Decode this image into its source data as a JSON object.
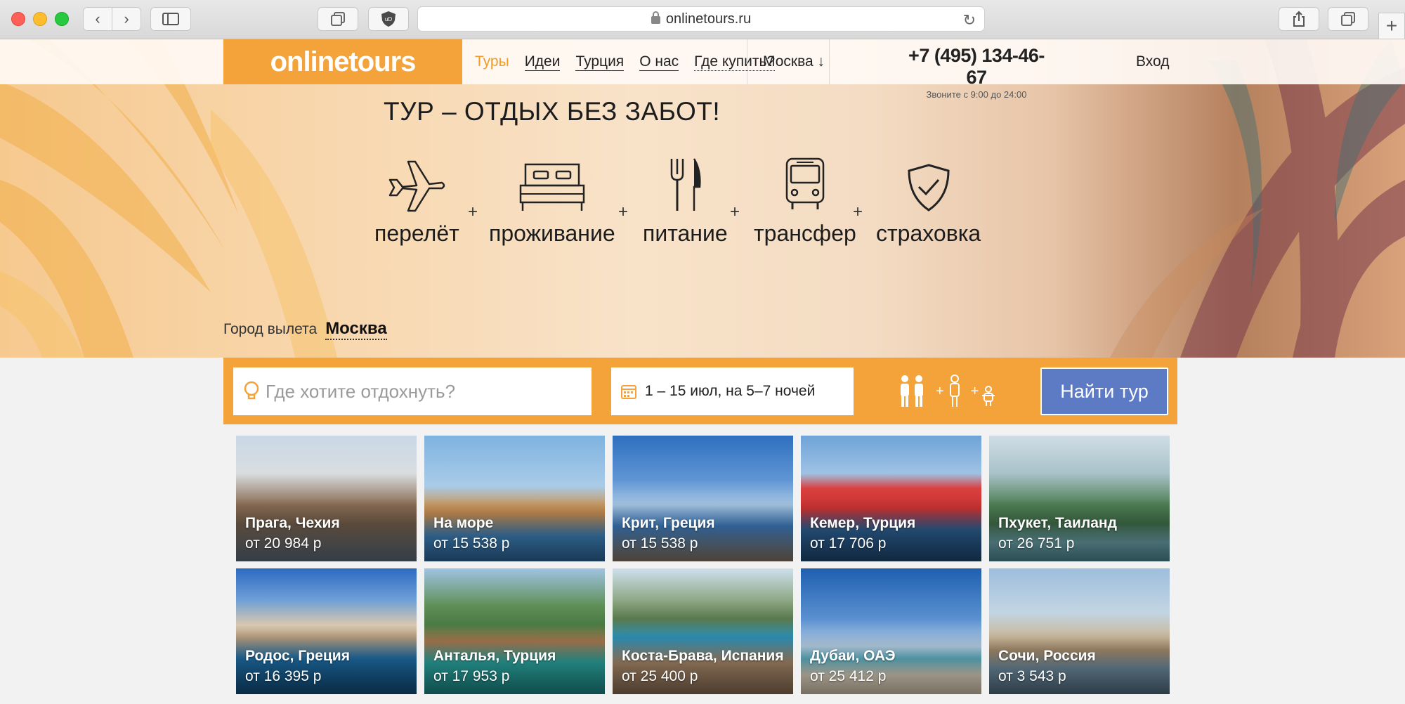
{
  "browser": {
    "url": "onlinetours.ru"
  },
  "header": {
    "logo": "onlinetours",
    "nav": [
      {
        "label": "Туры"
      },
      {
        "label": "Идеи"
      },
      {
        "label": "Турция"
      },
      {
        "label": "О нас"
      },
      {
        "label": "Где купить?"
      }
    ],
    "city": "Москва ↓",
    "phone": "+7 (495) 134-46-67",
    "phone_hours": "Звоните с 9:00 до 24:00",
    "login": "Вход"
  },
  "hero": {
    "title": "ТУР – ОТДЫХ БЕЗ ЗАБОТ!",
    "features": [
      {
        "label": "перелёт",
        "icon": "airplane-icon"
      },
      {
        "label": "проживание",
        "icon": "bed-icon"
      },
      {
        "label": "питание",
        "icon": "fork-knife-icon"
      },
      {
        "label": "трансфер",
        "icon": "bus-icon"
      },
      {
        "label": "страховка",
        "icon": "shield-check-icon"
      }
    ],
    "plus": "+",
    "departure_label": "Город вылета",
    "departure_city": "Москва"
  },
  "search": {
    "destination_placeholder": "Где хотите отдохнуть?",
    "destination_value": "",
    "dates": "1 – 15 июл, на 5–7 ночей",
    "adults_plus": "+",
    "child_plus": "+",
    "button": "Найти тур"
  },
  "destinations": [
    {
      "title": "Прага, Чехия",
      "price": "от 20 984 р"
    },
    {
      "title": "На море",
      "price": "от 15 538 р"
    },
    {
      "title": "Крит, Греция",
      "price": "от 15 538 р"
    },
    {
      "title": "Кемер, Турция",
      "price": "от 17 706 р"
    },
    {
      "title": "Пхукет, Таиланд",
      "price": "от 26 751 р"
    },
    {
      "title": "Родос, Греция",
      "price": "от 16 395 р"
    },
    {
      "title": "Анталья, Турция",
      "price": "от 17 953 р"
    },
    {
      "title": "Коста-Брава, Испания",
      "price": "от 25 400 р"
    },
    {
      "title": "Дубаи, ОАЭ",
      "price": "от 25 412 р"
    },
    {
      "title": "Сочи, Россия",
      "price": "от 3 543 р"
    }
  ],
  "colors": {
    "brand_orange": "#f4a23a",
    "nav_active": "#f29a26",
    "button_blue": "#5d7ac4"
  }
}
